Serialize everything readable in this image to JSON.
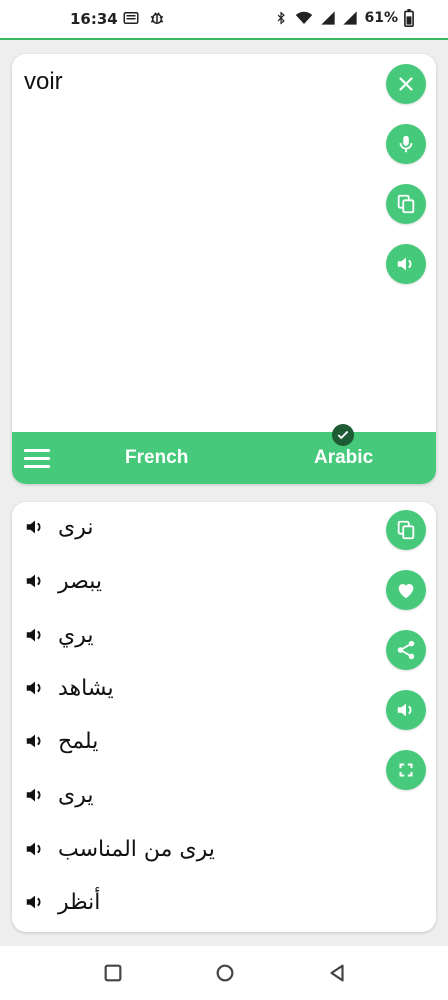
{
  "status_bar": {
    "time": "16:34",
    "battery": "61%"
  },
  "input": {
    "text": "voir"
  },
  "languages": {
    "source": "French",
    "target": "Arabic"
  },
  "results": [
    {
      "word": "نرى"
    },
    {
      "word": "يبصر"
    },
    {
      "word": "يري"
    },
    {
      "word": "يشاهد"
    },
    {
      "word": "يلمح"
    },
    {
      "word": "يرى"
    },
    {
      "word": "يرى من المناسب"
    },
    {
      "word": "أنظر"
    }
  ],
  "colors": {
    "accent": "#46c97a",
    "check": "#1d5b34"
  }
}
